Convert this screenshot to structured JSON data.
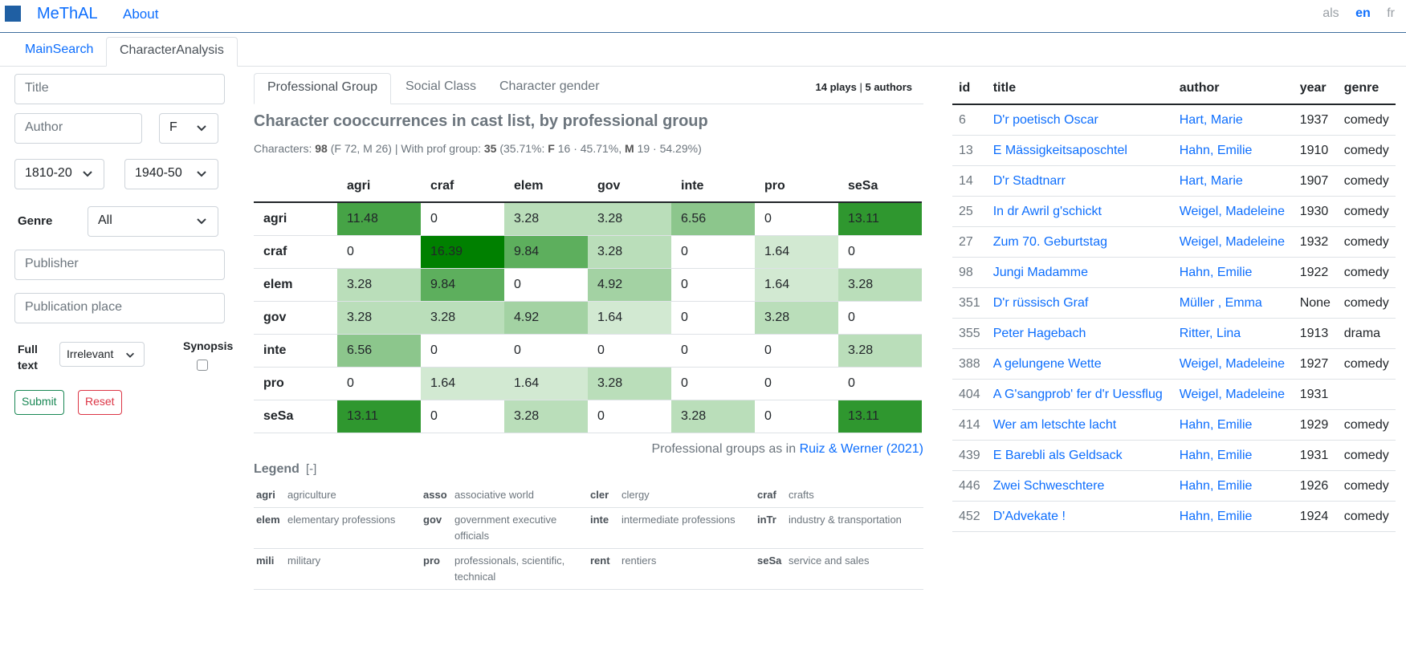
{
  "nav": {
    "brand": "MeThAL",
    "about": "About",
    "languages": [
      "als",
      "en",
      "fr"
    ],
    "active_language": "en"
  },
  "main_tabs": [
    "MainSearch",
    "CharacterAnalysis"
  ],
  "form": {
    "title_placeholder": "Title",
    "author_placeholder": "Author",
    "gender_value": "F",
    "period_from": "1810-20",
    "period_to": "1940-50",
    "genre_label": "Genre",
    "genre_value": "All",
    "publisher_placeholder": "Publisher",
    "pubplace_placeholder": "Publication place",
    "fulltext_label_1": "Full",
    "fulltext_label_2": "text",
    "fulltext_value": "Irrelevant",
    "synopsis_label": "Synopsis",
    "submit_label": "Submit",
    "reset_label": "Reset"
  },
  "sub_tabs": [
    "Professional Group",
    "Social Class",
    "Character gender"
  ],
  "counts": {
    "plays_n": "14",
    "plays_label": "plays",
    "sep": "|",
    "authors_n": "5",
    "authors_label": "authors"
  },
  "heading": "Character cooccurrences in cast list, by professional group",
  "summary": {
    "characters_label": "Characters:",
    "characters_n": "98",
    "characters_detail": "(F 72, M 26) | With prof group:",
    "with_prof_n": "35",
    "pct": "(35.71%",
    "sep": ":",
    "f_label": "F",
    "f_detail": "16 · 45.71%,",
    "m_label": "M",
    "m_detail": "19 · 54.29%)"
  },
  "matrix": {
    "columns": [
      "agri",
      "craf",
      "elem",
      "gov",
      "inte",
      "pro",
      "seSa"
    ],
    "rows": [
      {
        "label": "agri",
        "values": [
          "11.48",
          "0",
          "3.28",
          "3.28",
          "6.56",
          "0",
          "13.11"
        ]
      },
      {
        "label": "craf",
        "values": [
          "0",
          "16.39",
          "9.84",
          "3.28",
          "0",
          "1.64",
          "0"
        ]
      },
      {
        "label": "elem",
        "values": [
          "3.28",
          "9.84",
          "0",
          "4.92",
          "0",
          "1.64",
          "3.28"
        ]
      },
      {
        "label": "gov",
        "values": [
          "3.28",
          "3.28",
          "4.92",
          "1.64",
          "0",
          "3.28",
          "0"
        ]
      },
      {
        "label": "inte",
        "values": [
          "6.56",
          "0",
          "0",
          "0",
          "0",
          "0",
          "3.28"
        ]
      },
      {
        "label": "pro",
        "values": [
          "0",
          "1.64",
          "1.64",
          "3.28",
          "0",
          "0",
          "0"
        ]
      },
      {
        "label": "seSa",
        "values": [
          "13.11",
          "0",
          "3.28",
          "0",
          "3.28",
          "0",
          "13.11"
        ]
      }
    ],
    "max_value": 16.39,
    "heat_color": "#008000"
  },
  "source": {
    "prefix": "Professional groups as in",
    "link": "Ruiz & Werner (2021)"
  },
  "legend": {
    "title": "Legend",
    "toggle": "[-]",
    "rows": [
      [
        {
          "code": "agri",
          "desc": "agriculture"
        },
        {
          "code": "asso",
          "desc": "associative world"
        },
        {
          "code": "cler",
          "desc": "clergy"
        },
        {
          "code": "craf",
          "desc": "crafts"
        }
      ],
      [
        {
          "code": "elem",
          "desc": "elementary professions"
        },
        {
          "code": "gov",
          "desc": "government executive officials"
        },
        {
          "code": "inte",
          "desc": "intermediate professions"
        },
        {
          "code": "inTr",
          "desc": "industry & transportation"
        }
      ],
      [
        {
          "code": "mili",
          "desc": "military"
        },
        {
          "code": "pro",
          "desc": "professionals, scientific, technical"
        },
        {
          "code": "rent",
          "desc": "rentiers"
        },
        {
          "code": "seSa",
          "desc": "service and sales"
        }
      ]
    ]
  },
  "plays": {
    "headers": [
      "id",
      "title",
      "author",
      "year",
      "genre"
    ],
    "rows": [
      {
        "id": "6",
        "title": "D'r poetisch Oscar",
        "author": "Hart, Marie",
        "year": "1937",
        "genre": "comedy"
      },
      {
        "id": "13",
        "title": "E Mässigkeitsaposchtel",
        "author": "Hahn, Emilie",
        "year": "1910",
        "genre": "comedy"
      },
      {
        "id": "14",
        "title": "D'r Stadtnarr",
        "author": "Hart, Marie",
        "year": "1907",
        "genre": "comedy"
      },
      {
        "id": "25",
        "title": "In dr Awril g'schickt",
        "author": "Weigel, Madeleine",
        "year": "1930",
        "genre": "comedy"
      },
      {
        "id": "27",
        "title": "Zum 70. Geburtstag",
        "author": "Weigel, Madeleine",
        "year": "1932",
        "genre": "comedy"
      },
      {
        "id": "98",
        "title": "Jungi Madamme",
        "author": "Hahn, Emilie",
        "year": "1922",
        "genre": "comedy"
      },
      {
        "id": "351",
        "title": "D'r rüssisch Graf",
        "author": "Müller , Emma",
        "year": "None",
        "genre": "comedy"
      },
      {
        "id": "355",
        "title": "Peter Hagebach",
        "author": "Ritter, Lina",
        "year": "1913",
        "genre": "drama"
      },
      {
        "id": "388",
        "title": "A gelungene Wette",
        "author": "Weigel, Madeleine",
        "year": "1927",
        "genre": "comedy"
      },
      {
        "id": "404",
        "title": "A G'sangprob' fer d'r Uessflug",
        "author": "Weigel, Madeleine",
        "year": "1931",
        "genre": ""
      },
      {
        "id": "414",
        "title": "Wer am letschte lacht",
        "author": "Hahn, Emilie",
        "year": "1929",
        "genre": "comedy"
      },
      {
        "id": "439",
        "title": "E Barebli als Geldsack",
        "author": "Hahn, Emilie",
        "year": "1931",
        "genre": "comedy"
      },
      {
        "id": "446",
        "title": "Zwei Schweschtere",
        "author": "Hahn, Emilie",
        "year": "1926",
        "genre": "comedy"
      },
      {
        "id": "452",
        "title": "D'Advekate !",
        "author": "Hahn, Emilie",
        "year": "1924",
        "genre": "comedy"
      }
    ]
  }
}
